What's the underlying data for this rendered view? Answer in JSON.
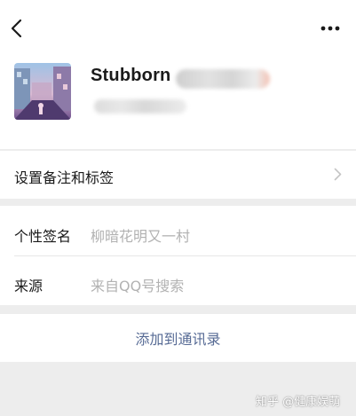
{
  "header": {
    "back_icon": "chevron-left-icon",
    "more_icon": "more-dots-icon"
  },
  "profile": {
    "name": "Stubborn"
  },
  "remark": {
    "label": "设置备注和标签"
  },
  "signature": {
    "label": "个性签名",
    "value": "柳暗花明又一村"
  },
  "source": {
    "label": "来源",
    "value": "来自QQ号搜索"
  },
  "actions": {
    "add_contact": "添加到通讯录"
  },
  "watermark": {
    "text": "知乎 @健康娱萌"
  },
  "colors": {
    "background": "#ededed",
    "panel": "#ffffff",
    "link_blue": "#576b95",
    "secondary_text": "#b2b2b2"
  }
}
